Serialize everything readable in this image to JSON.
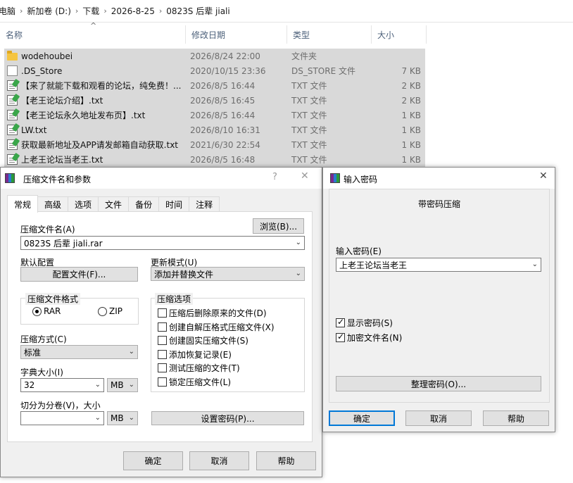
{
  "explorer": {
    "breadcrumb": [
      "电脑",
      "新加卷 (D:)",
      "下载",
      "2026-8-25",
      "0823S 后辈 jiali"
    ],
    "columns": {
      "name": "名称",
      "date": "修改日期",
      "type": "类型",
      "size": "大小"
    },
    "files": [
      {
        "name": "wodehoubei",
        "date": "2026/8/24 22:00",
        "type": "文件夹",
        "size": "",
        "icon": "folder-icon"
      },
      {
        "name": ".DS_Store",
        "date": "2020/10/15 23:36",
        "type": "DS_STORE 文件",
        "size": "7 KB",
        "icon": "file-icon"
      },
      {
        "name": "【来了就能下载和观看的论坛，纯免费！...",
        "date": "2026/8/5 16:44",
        "type": "TXT 文件",
        "size": "2 KB",
        "icon": "txt-icon"
      },
      {
        "name": "【老王论坛介绍】.txt",
        "date": "2026/8/5 16:45",
        "type": "TXT 文件",
        "size": "2 KB",
        "icon": "txt-icon"
      },
      {
        "name": "【老王论坛永久地址发布页】.txt",
        "date": "2026/8/5 16:44",
        "type": "TXT 文件",
        "size": "1 KB",
        "icon": "txt-icon"
      },
      {
        "name": "LW.txt",
        "date": "2026/8/10 16:31",
        "type": "TXT 文件",
        "size": "1 KB",
        "icon": "txt-icon"
      },
      {
        "name": "获取最新地址及APP请发邮箱自动获取.txt",
        "date": "2021/6/30 22:54",
        "type": "TXT 文件",
        "size": "1 KB",
        "icon": "txt-icon"
      },
      {
        "name": "上老王论坛当老王.txt",
        "date": "2026/8/5 16:48",
        "type": "TXT 文件",
        "size": "1 KB",
        "icon": "txt-icon"
      }
    ]
  },
  "archive_dialog": {
    "title": "压缩文件名和参数",
    "help": "?",
    "close": "✕",
    "tabs": [
      "常规",
      "高级",
      "选项",
      "文件",
      "备份",
      "时间",
      "注释"
    ],
    "archive_name_label": "压缩文件名(A)",
    "archive_name_value": "0823S 后辈 jiali.rar",
    "browse": "浏览(B)...",
    "default_profile_label": "默认配置",
    "profiles_button": "配置文件(F)...",
    "update_mode_label": "更新模式(U)",
    "update_mode_value": "添加并替换文件",
    "format_group": "压缩文件格式",
    "format_rar": "RAR",
    "format_zip": "ZIP",
    "options_group": "压缩选项",
    "options": [
      {
        "label": "压缩后删除原来的文件(D)",
        "checked": false
      },
      {
        "label": "创建自解压格式压缩文件(X)",
        "checked": false
      },
      {
        "label": "创建固实压缩文件(S)",
        "checked": false
      },
      {
        "label": "添加恢复记录(E)",
        "checked": false
      },
      {
        "label": "测试压缩的文件(T)",
        "checked": false
      },
      {
        "label": "锁定压缩文件(L)",
        "checked": false
      }
    ],
    "method_label": "压缩方式(C)",
    "method_value": "标准",
    "dict_label": "字典大小(I)",
    "dict_value": "32",
    "dict_unit": "MB",
    "split_label": "切分为分卷(V)，大小",
    "split_value": "",
    "split_unit": "MB",
    "set_password": "设置密码(P)...",
    "ok": "确定",
    "cancel": "取消",
    "help_button": "帮助"
  },
  "password_dialog": {
    "title": "输入密码",
    "close": "✕",
    "heading": "带密码压缩",
    "password_label": "输入密码(E)",
    "password_value": "上老王论坛当老王",
    "show_password": "显示密码(S)",
    "show_password_checked": true,
    "encrypt_names": "加密文件名(N)",
    "encrypt_names_checked": true,
    "organize": "整理密码(O)...",
    "ok": "确定",
    "cancel": "取消",
    "help_button": "帮助"
  }
}
